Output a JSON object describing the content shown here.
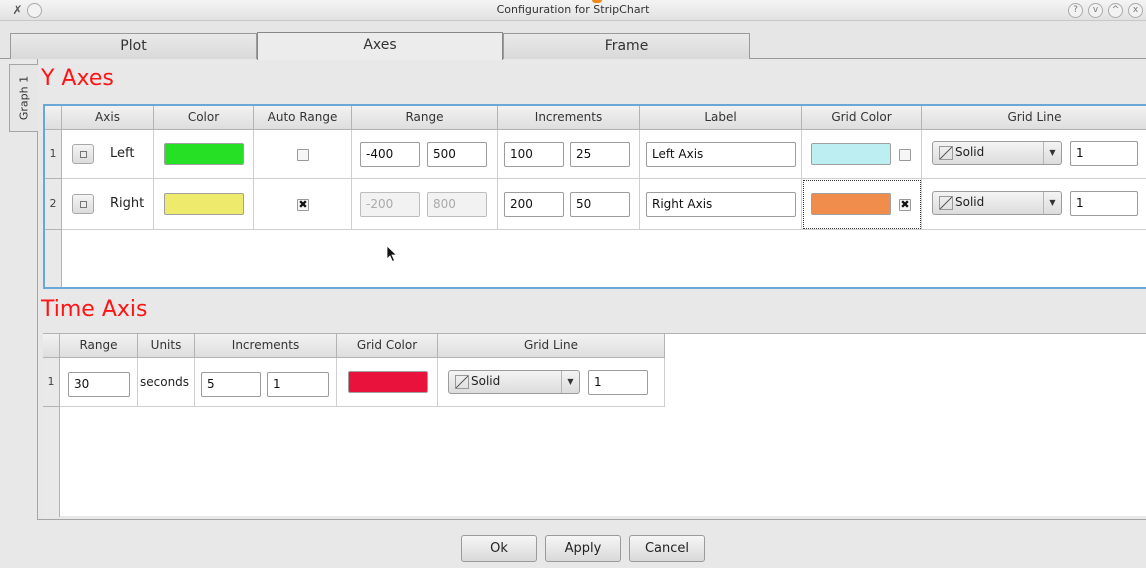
{
  "window": {
    "title": "Configuration for StripChart",
    "controls": [
      "?",
      "v",
      "^",
      "x"
    ]
  },
  "tabs": [
    {
      "label": "Plot",
      "active": false
    },
    {
      "label": "Axes",
      "active": true
    },
    {
      "label": "Frame",
      "active": false
    }
  ],
  "side_tab": {
    "label": "Graph 1"
  },
  "y_axes": {
    "title": "Y Axes",
    "headers": [
      "Axis",
      "Color",
      "Auto Range",
      "Range",
      "Increments",
      "Label",
      "Grid Color",
      "Grid Line"
    ],
    "rows": [
      {
        "num": "1",
        "axis": "Left",
        "color": "#25e025",
        "auto_range": false,
        "range_min": "-400",
        "range_max": "500",
        "range_enabled": true,
        "inc_major": "100",
        "inc_minor": "25",
        "label": "Left Axis",
        "grid_color": "#bdeef2",
        "grid_enabled": false,
        "grid_line": "Solid",
        "grid_width": "1"
      },
      {
        "num": "2",
        "axis": "Right",
        "color": "#eeeb6c",
        "auto_range": true,
        "range_min": "-200",
        "range_max": "800",
        "range_enabled": false,
        "inc_major": "200",
        "inc_minor": "50",
        "label": "Right Axis",
        "grid_color": "#f08c4c",
        "grid_enabled": true,
        "grid_line": "Solid",
        "grid_width": "1"
      }
    ]
  },
  "time_axis": {
    "title": "Time Axis",
    "headers": [
      "Range",
      "Units",
      "Increments",
      "Grid Color",
      "Grid Line"
    ],
    "row": {
      "num": "1",
      "range": "30",
      "units": "seconds",
      "inc_major": "5",
      "inc_minor": "1",
      "grid_color": "#e8123c",
      "grid_line": "Solid",
      "grid_width": "1"
    }
  },
  "buttons": {
    "ok": "Ok",
    "apply": "Apply",
    "cancel": "Cancel"
  },
  "colors": {
    "section_title": "#ff1414",
    "selection_border": "#6aa6d6"
  }
}
